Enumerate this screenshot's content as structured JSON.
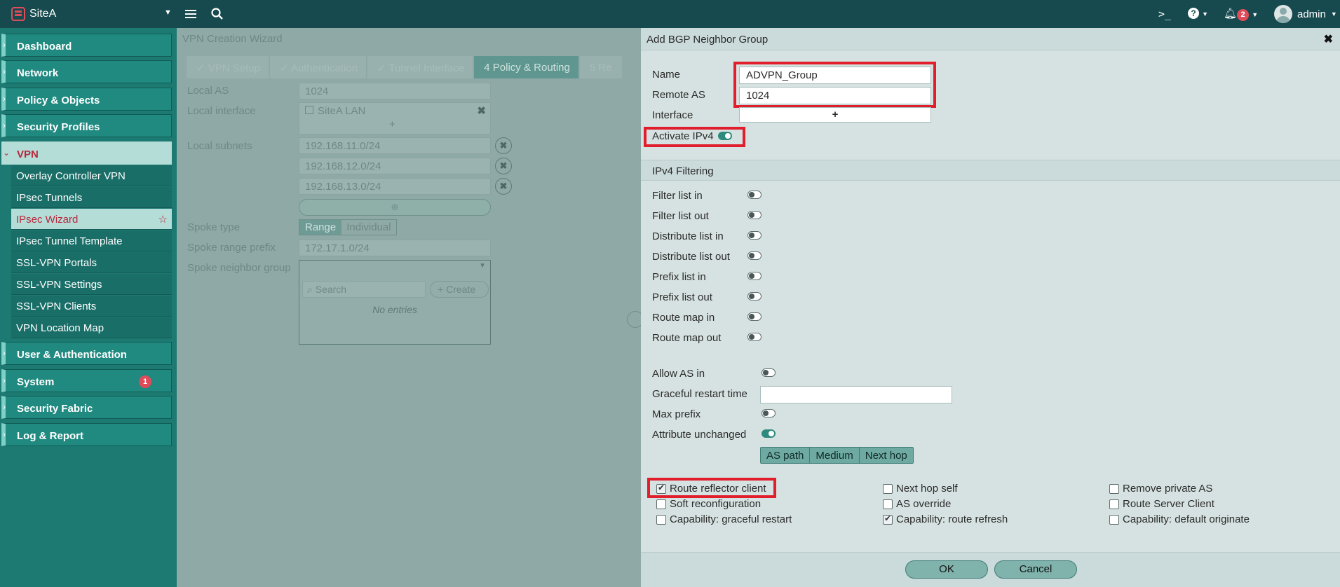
{
  "topbar": {
    "site_name": "SiteA",
    "cli_icon_text": ">_",
    "help_icon_text": "?",
    "notification_count": "2",
    "user_name": "admin"
  },
  "sidebar": {
    "items": [
      {
        "label": "Dashboard"
      },
      {
        "label": "Network"
      },
      {
        "label": "Policy & Objects"
      },
      {
        "label": "Security Profiles"
      },
      {
        "label": "VPN"
      },
      {
        "label": "User & Authentication"
      },
      {
        "label": "System",
        "badge": "1"
      },
      {
        "label": "Security Fabric"
      },
      {
        "label": "Log & Report"
      }
    ],
    "vpn_subitems": [
      {
        "label": "Overlay Controller VPN"
      },
      {
        "label": "IPsec Tunnels"
      },
      {
        "label": "IPsec Wizard"
      },
      {
        "label": "IPsec Tunnel Template"
      },
      {
        "label": "SSL-VPN Portals"
      },
      {
        "label": "SSL-VPN Settings"
      },
      {
        "label": "SSL-VPN Clients"
      },
      {
        "label": "VPN Location Map"
      }
    ]
  },
  "wizard": {
    "title": "VPN Creation Wizard",
    "steps": [
      "VPN Setup",
      "Authentication",
      "Tunnel Interface",
      "Policy & Routing",
      "Re"
    ],
    "step_numbers": [
      "4",
      "5"
    ],
    "local_as_label": "Local AS",
    "local_as_value": "1024",
    "local_interface_label": "Local interface",
    "local_interface_value": "SiteA LAN",
    "local_subnets_label": "Local subnets",
    "subnets": [
      "192.168.11.0/24",
      "192.168.12.0/24",
      "192.168.13.0/24"
    ],
    "spoke_type_label": "Spoke type",
    "spoke_type_options": [
      "Range",
      "Individual"
    ],
    "spoke_range_prefix_label": "Spoke range prefix",
    "spoke_range_prefix_value": "172.17.1.0/24",
    "spoke_neighbor_group_label": "Spoke neighbor group",
    "search_placeholder": "Search",
    "create_label": "Create",
    "no_entries": "No entries"
  },
  "dialog": {
    "title": "Add BGP Neighbor Group",
    "name_label": "Name",
    "name_value": "ADVPN_Group",
    "remote_as_label": "Remote AS",
    "remote_as_value": "1024",
    "interface_label": "Interface",
    "interface_add": "+",
    "activate_ipv4_label": "Activate IPv4",
    "ipv4_filtering_header": "IPv4 Filtering",
    "filters": [
      {
        "label": "Filter list in",
        "on": false
      },
      {
        "label": "Filter list out",
        "on": false
      },
      {
        "label": "Distribute list in",
        "on": false
      },
      {
        "label": "Distribute list out",
        "on": false
      },
      {
        "label": "Prefix list in",
        "on": false
      },
      {
        "label": "Prefix list out",
        "on": false
      },
      {
        "label": "Route map in",
        "on": false
      },
      {
        "label": "Route map out",
        "on": false
      }
    ],
    "allow_as_in_label": "Allow AS in",
    "graceful_restart_label": "Graceful restart time",
    "graceful_restart_value": "",
    "max_prefix_label": "Max prefix",
    "attribute_unchanged_label": "Attribute unchanged",
    "attribute_options": [
      "AS path",
      "Medium",
      "Next hop"
    ],
    "checkboxes": [
      {
        "label": "Route reflector client",
        "checked": true
      },
      {
        "label": "Soft reconfiguration",
        "checked": false
      },
      {
        "label": "Capability: graceful restart",
        "checked": false
      },
      {
        "label": "Next hop self",
        "checked": false
      },
      {
        "label": "AS override",
        "checked": false
      },
      {
        "label": "Capability: route refresh",
        "checked": true
      },
      {
        "label": "Remove private AS",
        "checked": false
      },
      {
        "label": "Route Server Client",
        "checked": false
      },
      {
        "label": "Capability: default originate",
        "checked": false
      }
    ],
    "ok_label": "OK",
    "cancel_label": "Cancel"
  },
  "colors": {
    "topbar": "#164a4e",
    "sidebar": "#1c7a72",
    "highlight_red": "#e01e2c",
    "active_nav_text": "#b8273c"
  }
}
